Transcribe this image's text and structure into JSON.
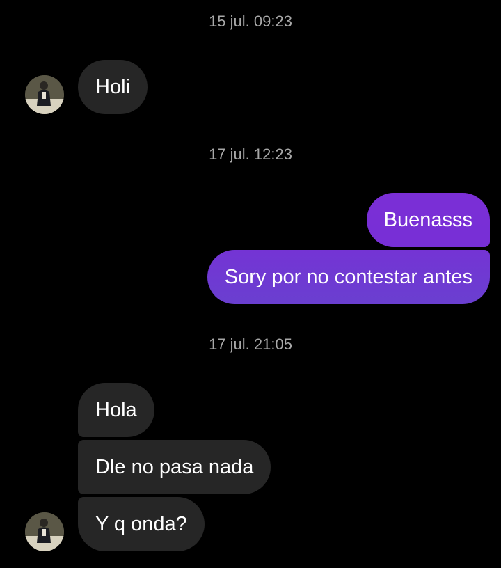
{
  "thread": {
    "groups": [
      {
        "timestamp": "15 jul. 09:23",
        "messages": [
          {
            "text": "Holi",
            "side": "incoming"
          }
        ]
      },
      {
        "timestamp": "17 jul. 12:23",
        "messages": [
          {
            "text": "Buenasss",
            "side": "outgoing"
          },
          {
            "text": "Sory por no contestar antes",
            "side": "outgoing"
          }
        ]
      },
      {
        "timestamp": "17 jul. 21:05",
        "messages": [
          {
            "text": "Hola",
            "side": "incoming"
          },
          {
            "text": "Dle no pasa nada",
            "side": "incoming"
          },
          {
            "text": "Y q onda?",
            "side": "incoming"
          }
        ]
      }
    ]
  },
  "colors": {
    "background": "#000000",
    "incoming_bubble": "#262626",
    "outgoing_gradient_top": "#7b2fd6",
    "outgoing_gradient_bottom": "#6a3fd0",
    "timestamp_text": "#a8a8a8"
  },
  "icons": {
    "contact_avatar": "profile-photo"
  }
}
